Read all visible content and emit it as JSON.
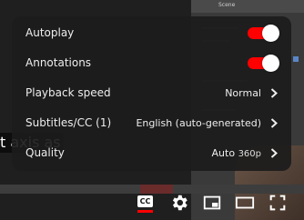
{
  "video_overlay": {
    "panel_title": "Scene",
    "subtitle_fragment": "t axis as"
  },
  "settings": {
    "autoplay": {
      "label": "Autoplay",
      "enabled": true
    },
    "annotations": {
      "label": "Annotations",
      "enabled": true
    },
    "playback_speed": {
      "label": "Playback speed",
      "value": "Normal"
    },
    "subtitles": {
      "label": "Subtitles/CC (1)",
      "value": "English (auto-generated)"
    },
    "quality": {
      "label": "Quality",
      "value": "Auto",
      "value_detail": "360p"
    }
  },
  "controls": {
    "subtitles_button_label": "CC",
    "icons": [
      "subtitles-icon",
      "settings-gear-icon",
      "miniplayer-icon",
      "theater-mode-icon",
      "fullscreen-icon"
    ]
  },
  "colors": {
    "toggle_on": "#ff0000",
    "accent_red": "#ff0000",
    "menu_bg": "#1c1c1c",
    "text": "#eeeeee"
  }
}
